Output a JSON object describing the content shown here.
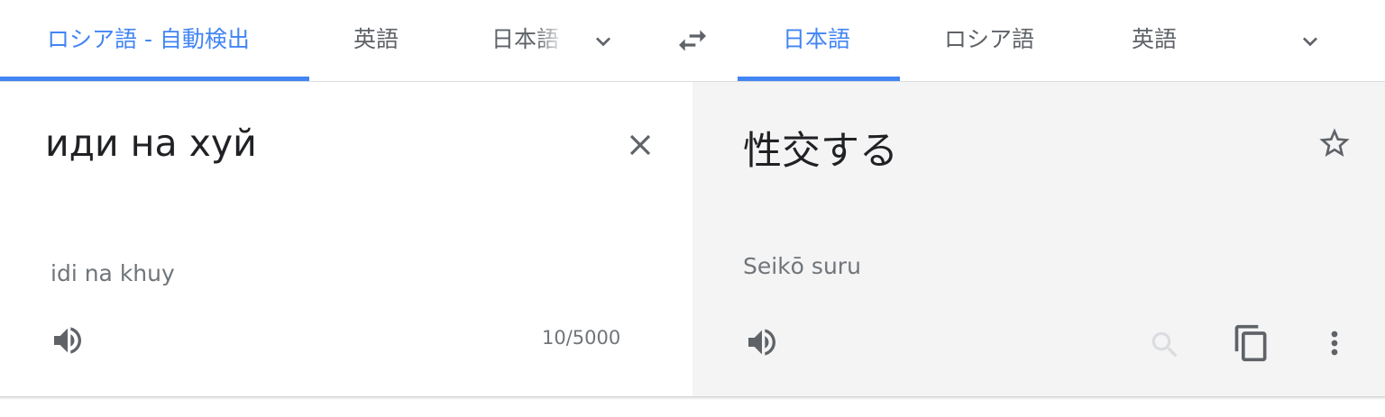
{
  "language_bar": {
    "source_tabs": [
      {
        "label": "ロシア語 - 自動検出",
        "active": true
      },
      {
        "label": "英語",
        "active": false
      },
      {
        "label": "日本語",
        "active": false
      }
    ],
    "target_tabs": [
      {
        "label": "日本語",
        "active": true
      },
      {
        "label": "ロシア語",
        "active": false
      },
      {
        "label": "英語",
        "active": false
      }
    ],
    "icons": {
      "source_more": "chevron-down-icon",
      "swap": "swap-languages-icon",
      "target_more": "chevron-down-icon"
    }
  },
  "source": {
    "text": "иди на хуй",
    "transliteration": "idi na khuy",
    "char_count": "10/5000",
    "icons": {
      "clear": "close-icon",
      "listen": "speaker-icon"
    }
  },
  "target": {
    "text": "性交する",
    "transliteration": "Seikō suru",
    "icons": {
      "save": "star-icon",
      "listen": "speaker-icon",
      "search": "search-icon",
      "copy": "copy-icon",
      "more": "more-vert-icon"
    }
  },
  "colors": {
    "accent": "#4285f4",
    "icon": "#5f6368",
    "muted_icon": "#dadce0",
    "target_bg": "#f4f4f4"
  }
}
